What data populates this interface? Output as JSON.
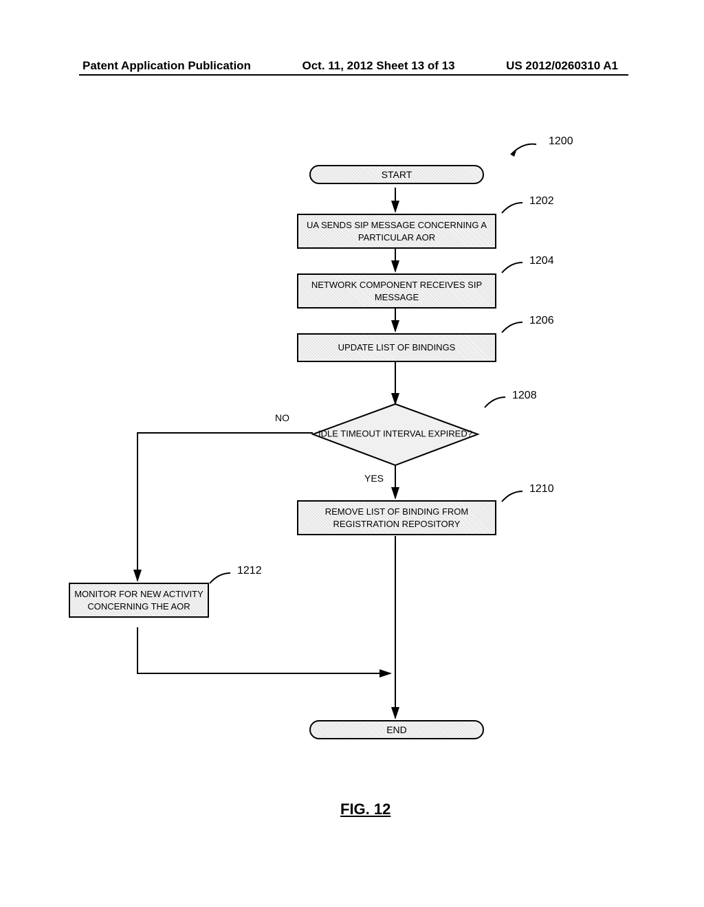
{
  "header": {
    "left": "Patent Application Publication",
    "center": "Oct. 11, 2012  Sheet 13 of 13",
    "right": "US 2012/0260310 A1"
  },
  "flow": {
    "start": "START",
    "step1202": "UA SENDS SIP MESSAGE CONCERNING A PARTICULAR AOR",
    "step1204": "NETWORK COMPONENT RECEIVES SIP MESSAGE",
    "step1206": "UPDATE LIST OF BINDINGS",
    "decision1208": "IDLE TIMEOUT INTERVAL EXPIRED?",
    "decision_yes": "YES",
    "decision_no": "NO",
    "step1210": "REMOVE LIST OF BINDING FROM REGISTRATION REPOSITORY",
    "step1212": "MONITOR FOR NEW ACTIVITY CONCERNING THE AOR",
    "end": "END"
  },
  "refs": {
    "r1200": "1200",
    "r1202": "1202",
    "r1204": "1204",
    "r1206": "1206",
    "r1208": "1208",
    "r1210": "1210",
    "r1212": "1212"
  },
  "figure": "FIG. 12"
}
